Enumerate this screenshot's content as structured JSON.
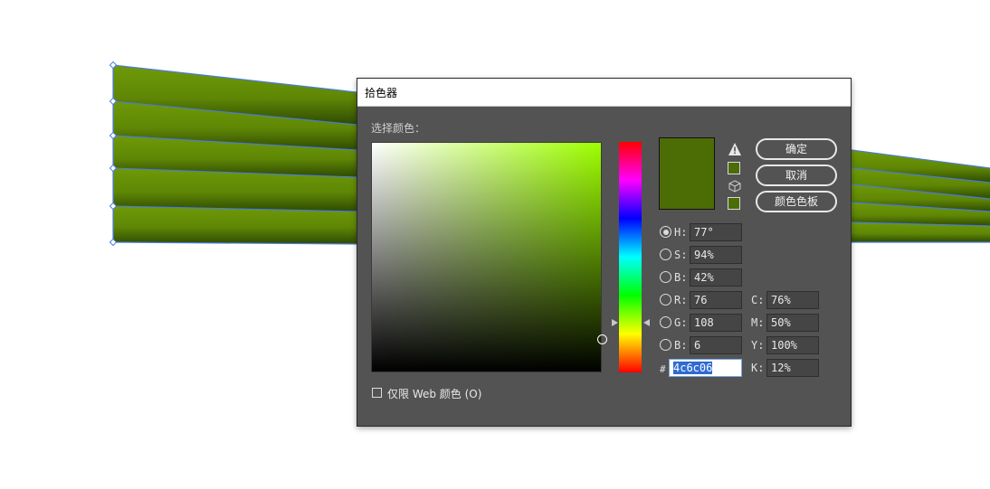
{
  "dialog": {
    "title": "拾色器",
    "select_label": "选择颜色：",
    "buttons": {
      "ok": "确定",
      "cancel": "取消",
      "swatches": "颜色色板"
    },
    "current_color": "#4c6c06",
    "hsb": {
      "h_label": "H:",
      "h_value": "77°",
      "s_label": "S:",
      "s_value": "94%",
      "b_label": "B:",
      "b_value": "42%"
    },
    "rgb": {
      "r_label": "R:",
      "r_value": "76",
      "g_label": "G:",
      "g_value": "108",
      "b_label": "B:",
      "b_value": "6"
    },
    "cmyk": {
      "c_label": "C:",
      "c_value": "76%",
      "m_label": "M:",
      "m_value": "50%",
      "y_label": "Y:",
      "y_value": "100%",
      "k_label": "K:",
      "k_value": "12%"
    },
    "hex_label": "#",
    "hex_value": "4c6c06",
    "web_only_label": "仅限 Web 颜色 (O)",
    "icons": {
      "warning": "warning-triangle-icon",
      "cube": "web-cube-icon"
    }
  },
  "artwork": {
    "fill_color": "#6a9406",
    "outline_color": "#4a7bdc"
  }
}
